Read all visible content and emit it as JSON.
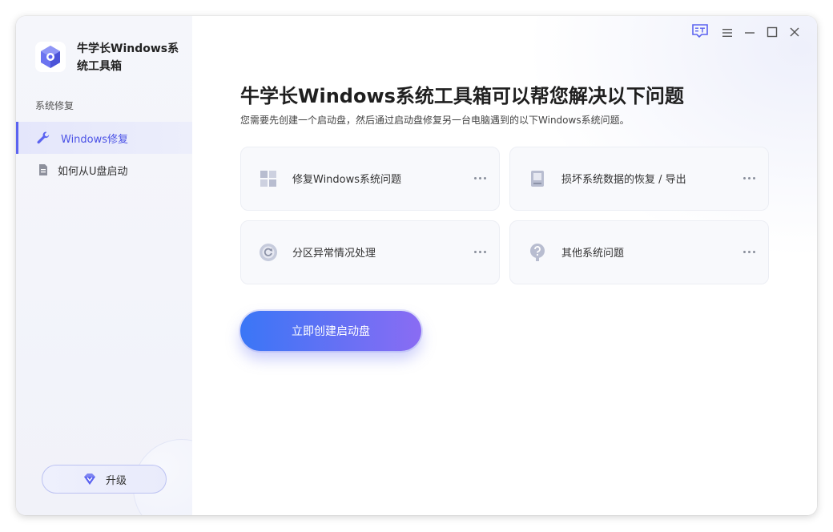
{
  "app": {
    "name": "牛学长Windows系统工具箱"
  },
  "sidebar": {
    "section_label": "系统修复",
    "items": [
      {
        "label": "Windows修复",
        "icon": "wrench-icon",
        "active": true
      },
      {
        "label": "如何从U盘启动",
        "icon": "document-icon",
        "active": false
      }
    ],
    "upgrade_label": "升级"
  },
  "main": {
    "headline": "牛学长Windows系统工具箱可以帮您解决以下问题",
    "subline": "您需要先创建一个启动盘，然后通过启动盘修复另一台电脑遇到的以下Windows系统问题。",
    "cards": [
      {
        "label": "修复Windows系统问题",
        "icon": "windows-grid-icon"
      },
      {
        "label": "损坏系统数据的恢复 / 导出",
        "icon": "drive-icon"
      },
      {
        "label": "分区异常情况处理",
        "icon": "partition-refresh-icon"
      },
      {
        "label": "其他系统问题",
        "icon": "question-icon"
      }
    ],
    "cta_label": "立即创建启动盘"
  },
  "titlebar": {
    "buttons": [
      "feedback-icon",
      "menu-icon",
      "minimize-icon",
      "maximize-icon",
      "close-icon"
    ]
  },
  "colors": {
    "accent": "#5b63f0",
    "cta_start": "#3a76f6",
    "cta_end": "#8a6cf3"
  }
}
